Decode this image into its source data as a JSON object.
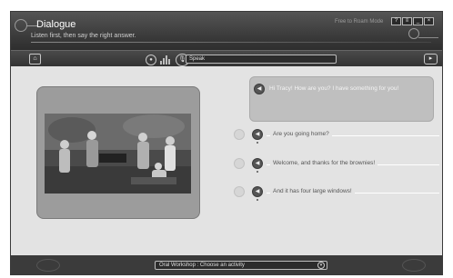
{
  "header": {
    "title": "Dialogue",
    "subtitle": "Listen first, then say the right answer.",
    "mode": "Free to Roam Mode",
    "window_buttons": [
      "?",
      "≡",
      "_",
      "×"
    ]
  },
  "toolbar": {
    "speak_field": "Speak"
  },
  "dialogue": {
    "prompt": "Hi Tracy! How are you? I have something for you!",
    "options": [
      {
        "label": "Are you going home?"
      },
      {
        "label": "Welcome, and thanks for the brownies!"
      },
      {
        "label": "And it has four large windows!"
      }
    ]
  },
  "footer": {
    "activity_select": "Oral Workshop : Choose an activity"
  },
  "colors": {
    "header_bg": "#3c3c3c",
    "body_bg": "#e3e3e3",
    "panel": "#9c9c9c",
    "bubble": "#bfbfbf"
  }
}
